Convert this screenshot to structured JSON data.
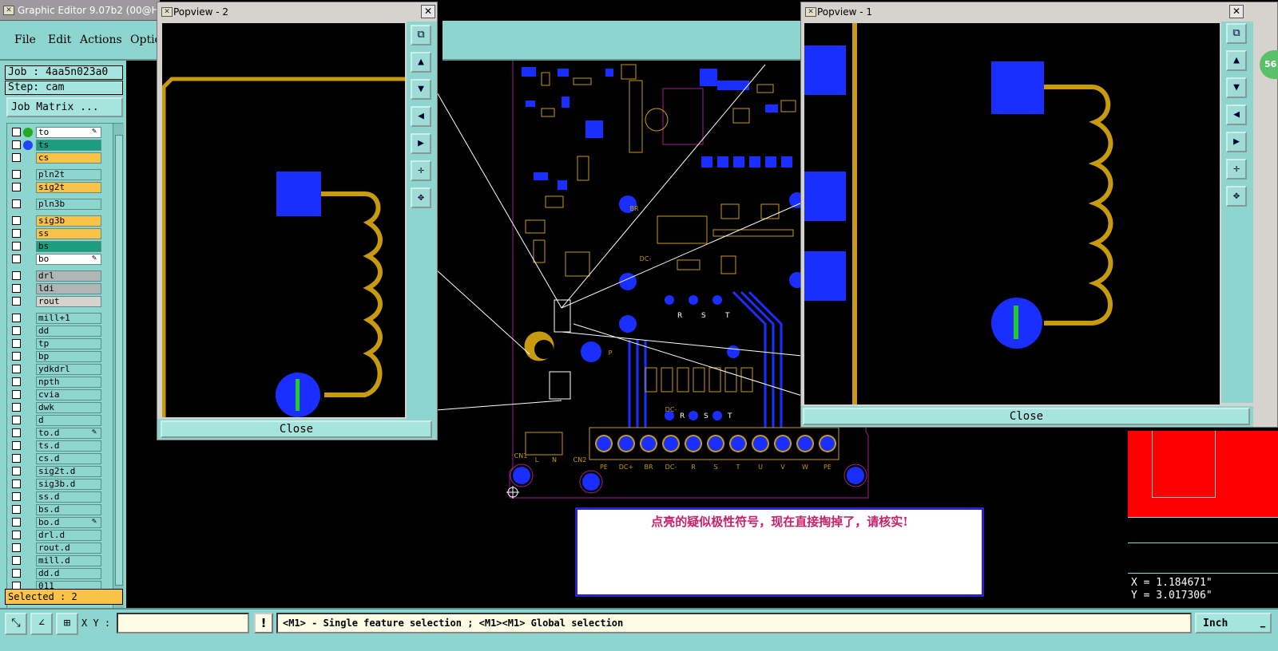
{
  "main": {
    "title": "Graphic Editor 9.07b2 (00@HY-",
    "menu": [
      "File",
      "Edit",
      "Actions",
      "Optic"
    ]
  },
  "left": {
    "job": "Job : 4aa5n023a0",
    "step": "Step: cam",
    "job_matrix": "Job Matrix ...",
    "layers": [
      {
        "name": "to",
        "color": "#ffffff",
        "dot": "#22aa22",
        "edit": true
      },
      {
        "name": "ts",
        "color": "#1b9e80",
        "dot": "#2244ff",
        "edit": false
      },
      {
        "name": "cs",
        "color": "#fbc248",
        "dot": "",
        "edit": false
      },
      {
        "name": "pln2t",
        "color": "#8ed5cf",
        "dot": "",
        "edit": false
      },
      {
        "name": "sig2t",
        "color": "#fbc248",
        "dot": "",
        "edit": false
      },
      {
        "name": "pln3b",
        "color": "#8ed5cf",
        "dot": "",
        "edit": false
      },
      {
        "name": "sig3b",
        "color": "#fbc248",
        "dot": "",
        "edit": false
      },
      {
        "name": "ss",
        "color": "#fbc248",
        "dot": "",
        "edit": false
      },
      {
        "name": "bs",
        "color": "#1b9e80",
        "dot": "",
        "edit": false
      },
      {
        "name": "bo",
        "color": "#ffffff",
        "dot": "",
        "edit": true
      },
      {
        "name": "drl",
        "color": "#b0b6b5",
        "dot": "",
        "edit": false
      },
      {
        "name": "ldi",
        "color": "#b0b6b5",
        "dot": "",
        "edit": false
      },
      {
        "name": "rout",
        "color": "#d6d3ce",
        "dot": "",
        "edit": false
      },
      {
        "name": "mill+1",
        "color": "#8ed5cf",
        "dot": "",
        "edit": false
      },
      {
        "name": "dd",
        "color": "#8ed5cf",
        "dot": "",
        "edit": false
      },
      {
        "name": "tp",
        "color": "#8ed5cf",
        "dot": "",
        "edit": false
      },
      {
        "name": "bp",
        "color": "#8ed5cf",
        "dot": "",
        "edit": false
      },
      {
        "name": "ydkdrl",
        "color": "#8ed5cf",
        "dot": "",
        "edit": false
      },
      {
        "name": "npth",
        "color": "#8ed5cf",
        "dot": "",
        "edit": false
      },
      {
        "name": "cvia",
        "color": "#8ed5cf",
        "dot": "",
        "edit": false
      },
      {
        "name": "dwk",
        "color": "#8ed5cf",
        "dot": "",
        "edit": false
      },
      {
        "name": "d",
        "color": "#8ed5cf",
        "dot": "",
        "edit": false
      },
      {
        "name": "to.d",
        "color": "#8ed5cf",
        "dot": "",
        "edit": true
      },
      {
        "name": "ts.d",
        "color": "#8ed5cf",
        "dot": "",
        "edit": false
      },
      {
        "name": "cs.d",
        "color": "#8ed5cf",
        "dot": "",
        "edit": false
      },
      {
        "name": "sig2t.d",
        "color": "#8ed5cf",
        "dot": "",
        "edit": false
      },
      {
        "name": "sig3b.d",
        "color": "#8ed5cf",
        "dot": "",
        "edit": false
      },
      {
        "name": "ss.d",
        "color": "#8ed5cf",
        "dot": "",
        "edit": false
      },
      {
        "name": "bs.d",
        "color": "#8ed5cf",
        "dot": "",
        "edit": false
      },
      {
        "name": "bo.d",
        "color": "#8ed5cf",
        "dot": "",
        "edit": true
      },
      {
        "name": "drl.d",
        "color": "#8ed5cf",
        "dot": "",
        "edit": false
      },
      {
        "name": "rout.d",
        "color": "#8ed5cf",
        "dot": "",
        "edit": false
      },
      {
        "name": "mill.d",
        "color": "#8ed5cf",
        "dot": "",
        "edit": false
      },
      {
        "name": "dd.d",
        "color": "#8ed5cf",
        "dot": "",
        "edit": false
      },
      {
        "name": "011",
        "color": "#8ed5cf",
        "dot": "",
        "edit": false
      }
    ],
    "selected": "Selected : 2"
  },
  "popview2": {
    "title": "Popview - 2",
    "close": "Close"
  },
  "popview1": {
    "title": "Popview - 1",
    "close": "Close",
    "badge": "56"
  },
  "note": "点亮的疑似极性符号，现在直接掏掉了，请核实!",
  "board_labels": {
    "terminals": [
      "PE",
      "DC+",
      "BR",
      "DC-",
      "R",
      "S",
      "T",
      "U",
      "V",
      "W",
      "PE"
    ],
    "cn1": "CN1",
    "cn2": "CN2",
    "l": "L",
    "n": "N",
    "rst": [
      "R",
      "S",
      "T"
    ],
    "rst2": [
      "R",
      "S",
      "T"
    ],
    "br": "BR",
    "dc_minus": "DC-",
    "dc_minus2": "DC-",
    "p": "P"
  },
  "coords": {
    "x": "X = 1.184671\"",
    "y": "Y = 3.017306\""
  },
  "status": {
    "xy_label": "X Y :",
    "xy_value": "",
    "warn": "!",
    "message": "<M1> - Single feature selection ; <M1><M1> Global selection",
    "unit": "Inch"
  },
  "colors": {
    "pad": "#1a2fff",
    "trace": "#c89a10",
    "outline": "#a0208c",
    "teal": "#8ed5cf"
  }
}
